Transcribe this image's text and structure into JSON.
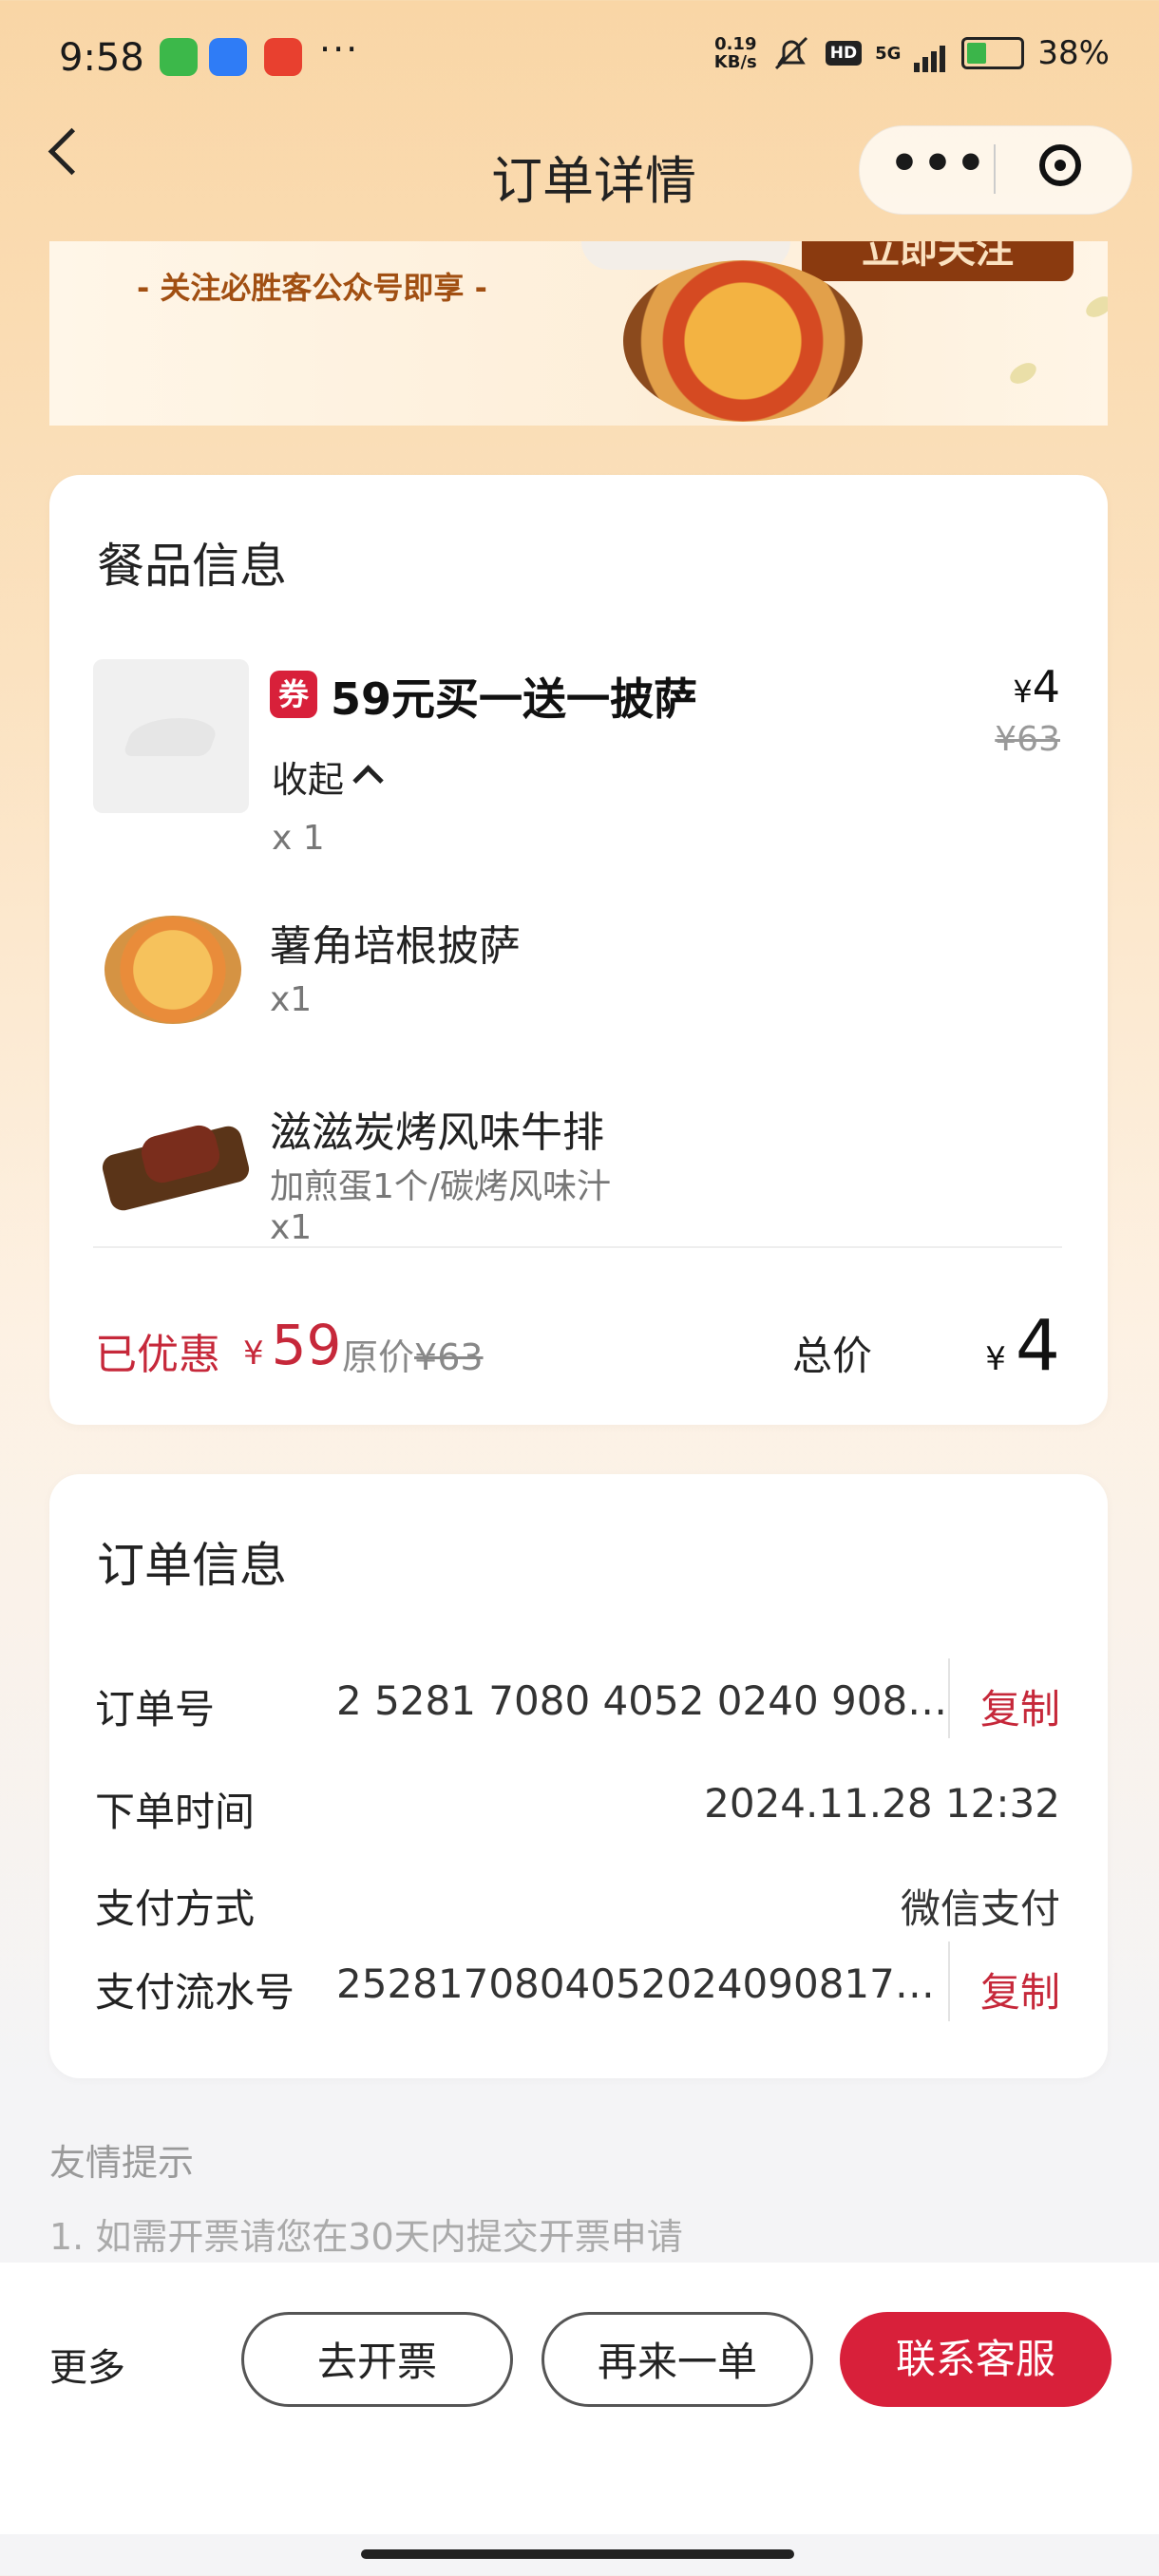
{
  "status_bar": {
    "time": "9:58",
    "dots": "···",
    "net_speed_top": "0.19",
    "net_speed_unit": "KB/s",
    "hd": "HD",
    "signal": "5G",
    "battery": "38%"
  },
  "nav": {
    "title": "订单详情"
  },
  "banner": {
    "text": "- 关注必胜客公众号即享 -",
    "follow_label": "立即关注"
  },
  "food": {
    "title": "餐品信息",
    "coupon_badge": "券",
    "main_item": {
      "name": "59元买一送一披萨",
      "collapse_label": "收起",
      "qty": "x 1",
      "price": "4",
      "price_currency": "¥",
      "orig_price": "¥63"
    },
    "sub_items": [
      {
        "name": "薯角培根披萨",
        "qty": "x1"
      },
      {
        "name": "滋滋炭烤风味牛排",
        "spec": "加煎蛋1个/碳烤风味汁",
        "qty": "x1"
      }
    ],
    "summary": {
      "saved_label": "已优惠",
      "saved_currency": "¥",
      "saved_amount": "59",
      "orig_label": "原价",
      "orig_amount": "¥63",
      "total_label": "总价",
      "total_currency": "¥",
      "total_amount": "4"
    }
  },
  "order": {
    "title": "订单信息",
    "rows": [
      {
        "label": "订单号",
        "value": "2 5281 7080 4052 0240 908…",
        "action": "复制"
      },
      {
        "label": "下单时间",
        "value": "2024.11.28 12:32"
      },
      {
        "label": "支付方式",
        "value": "微信支付"
      },
      {
        "label": "支付流水号",
        "value": "2528170804052024090817…",
        "action": "复制"
      }
    ]
  },
  "tips": {
    "title": "友情提示",
    "line1": "1. 如需开票请您在30天内提交开票申请"
  },
  "bottom": {
    "more": "更多",
    "invoice": "去开票",
    "reorder": "再来一单",
    "service": "联系客服"
  },
  "colors": {
    "accent_red": "#d8203a",
    "price_red": "#c6283a"
  }
}
